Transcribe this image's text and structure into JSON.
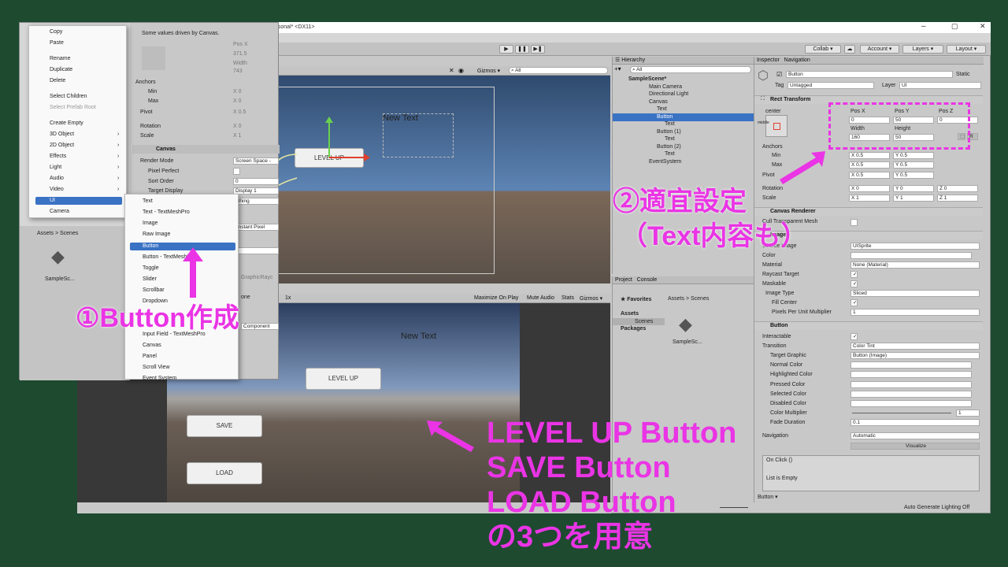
{
  "title_text": "Personal* <DX11>",
  "toolbar": {
    "collab": "Collab ▾",
    "account": "Account ▾",
    "layers": "Layers ▾",
    "layout": "Layout ▾",
    "gizmos": "Gizmos ▾",
    "search": "All"
  },
  "hierarchy": {
    "title": "Hierarchy",
    "search": "All",
    "items": [
      "SampleScene*",
      "Main Camera",
      "Directional Light",
      "Canvas",
      "Text",
      "Button",
      "Text",
      "Button (1)",
      "Text",
      "Button (2)",
      "Text",
      "EventSystem"
    ]
  },
  "project": {
    "tab1": "Project",
    "tab2": "Console",
    "favorites": "Favorites",
    "assets": "Assets",
    "scenes": "Scenes",
    "packages": "Packages",
    "breadcrumb": "Assets > Scenes",
    "file": "SampleSc..."
  },
  "scene": {
    "new_text": "New Text",
    "level_up": "LEVEL UP"
  },
  "game": {
    "toolbar": "1x",
    "maximize": "Maximize On Play",
    "mute": "Mute Audio",
    "stats": "Stats",
    "gizmos": "Gizmos ▾",
    "new_text": "New Text",
    "level_up": "LEVEL UP",
    "save": "SAVE",
    "load": "LOAD"
  },
  "inspector": {
    "tab": "Inspector",
    "tab2": "Navigation",
    "name": "Button",
    "static": "Static",
    "tag_label": "Tag",
    "tag": "Untagged",
    "layer_label": "Layer",
    "layer": "UI",
    "rect": "Rect Transform",
    "center": "center",
    "middle": "middle",
    "posx_l": "Pos X",
    "posy_l": "Pos Y",
    "posz_l": "Pos Z",
    "posx": "0",
    "posy": "50",
    "posz": "0",
    "width_l": "Width",
    "height_l": "Height",
    "width": "160",
    "height": "50",
    "r": "R",
    "anchors": "Anchors",
    "min": "Min",
    "max": "Max",
    "pivot": "Pivot",
    "rotation": "Rotation",
    "scale": "Scale",
    "ax": "X 0.5",
    "ay": "Y 0.5",
    "pvx": "X 0.5",
    "pvy": "Y 0.5",
    "rx": "X 0",
    "ry": "Y 0",
    "rz": "Z 0",
    "sx": "X 1",
    "sy": "Y 1",
    "sz": "Z 1",
    "canvas_renderer": "Canvas Renderer",
    "cull": "Cull Transparent Mesh",
    "image": "Image",
    "source": "Source Image",
    "source_v": "UISprite",
    "color": "Color",
    "material": "Material",
    "material_v": "None (Material)",
    "raycast": "Raycast Target",
    "maskable": "Maskable",
    "image_type": "Image Type",
    "image_type_v": "Sliced",
    "fill": "Fill Center",
    "ppu": "Pixels Per Unit Multiplier",
    "ppu_v": "1",
    "button": "Button",
    "interactable": "Interactable",
    "transition": "Transition",
    "transition_v": "Color Tint",
    "target": "Target Graphic",
    "target_v": "Button (Image)",
    "normal": "Normal Color",
    "highlighted": "Highlighted Color",
    "pressed": "Pressed Color",
    "selected": "Selected Color",
    "disabled": "Disabled Color",
    "multiplier": "Color Multiplier",
    "multiplier_v": "1",
    "fade": "Fade Duration",
    "fade_v": "0.1",
    "navigation": "Navigation",
    "navigation_v": "Automatic",
    "visualize": "Visualize",
    "onclick": "On Click ()",
    "list_empty": "List is Empty",
    "footer": "Button ▾"
  },
  "status": "Auto Generate Lighting Off",
  "left_inspector": {
    "note": "Some values driven by Canvas.",
    "posx": "Pos X",
    "posx_v": "371.5",
    "width": "Width",
    "width_v": "743",
    "anchors": "Anchors",
    "min": "Min",
    "max": "Max",
    "pivot": "Pivot",
    "rotation": "Rotation",
    "scale": "Scale",
    "min_v": "X 0",
    "max_v": "X 0",
    "pivot_v": "X 0.5",
    "rot_v": "X 0",
    "scale_v": "X 1",
    "canvas": "Canvas",
    "render_mode": "Render Mode",
    "render_mode_v": "Screen Space -",
    "pixel_perfect": "Pixel Perfect",
    "sort_order": "Sort Order",
    "sort_order_v": "0",
    "target_display": "Target Display",
    "target_display_v": "Display 1",
    "nothing": "othing",
    "constant": "onstant Pixel",
    "zero": "0",
    "graphic": "GraphicRayc",
    "one": "one",
    "component": "Component"
  },
  "context_menu": [
    "Copy",
    "Paste",
    "Rename",
    "Duplicate",
    "Delete",
    "Select Children",
    "Select Prefab Root",
    "Create Empty",
    "3D Object",
    "2D Object",
    "Effects",
    "Light",
    "Audio",
    "Video",
    "UI",
    "Camera"
  ],
  "ui_submenu": [
    "Text",
    "Text - TextMeshPro",
    "Image",
    "Raw Image",
    "Button",
    "Button - TextMeshPro",
    "Toggle",
    "Slider",
    "Scrollbar",
    "Dropdown",
    "",
    "",
    "Input Field - TextMeshPro",
    "Canvas",
    "Panel",
    "Scroll View",
    "Event System"
  ],
  "left_project": {
    "breadcrumb": "Assets > Scenes",
    "file": "SampleSc..."
  },
  "annotations": {
    "step1": "①Button作成",
    "step2a": "②適宜設定",
    "step2b": "（Text内容も）",
    "bottom": [
      "LEVEL UP Button",
      "SAVE Button",
      "LOAD Button",
      "の3つを用意"
    ]
  },
  "colors": {
    "annotation": "#ea34e5",
    "selection": "#3a72c4",
    "background": "#1e4a30"
  }
}
